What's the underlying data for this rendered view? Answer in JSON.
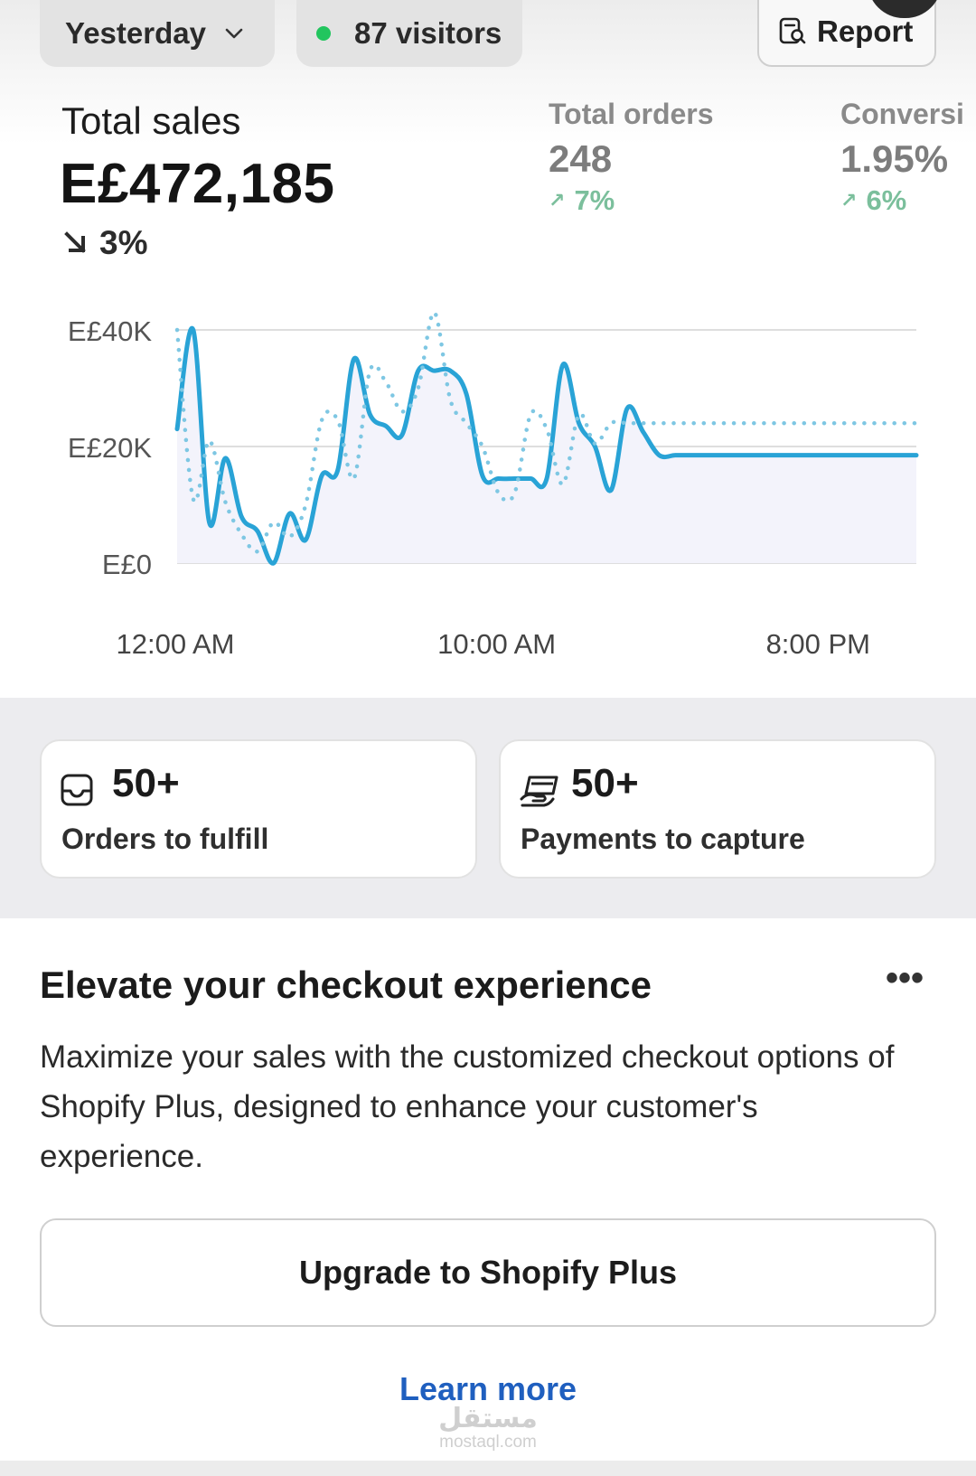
{
  "header": {
    "date_filter": "Yesterday",
    "visitors": "87 visitors",
    "report_label": "Report"
  },
  "metrics": {
    "total_sales": {
      "label": "Total sales",
      "value": "E£472,185",
      "change": "3%",
      "direction": "down"
    },
    "total_orders": {
      "label": "Total orders",
      "value": "248",
      "change": "7%",
      "direction": "up"
    },
    "conversion": {
      "label": "Conversi",
      "value": "1.95%",
      "change": "6%",
      "direction": "up"
    }
  },
  "chart_data": {
    "type": "line",
    "y_tick_labels": [
      "E£40K",
      "E£20K",
      "E£0"
    ],
    "x_tick_labels": [
      "12:00 AM",
      "10:00 AM",
      "8:00 PM"
    ],
    "ylim": [
      0,
      40000
    ],
    "grid": true,
    "x": [
      0,
      0.5,
      1,
      1.5,
      2,
      2.5,
      3,
      3.5,
      4,
      4.5,
      5,
      5.5,
      6,
      6.5,
      7,
      7.5,
      8,
      8.5,
      9,
      9.5,
      10,
      10.5,
      11,
      11.5,
      12,
      12.5,
      13,
      13.5,
      14,
      14.5,
      15,
      15.5,
      16,
      16.5,
      17,
      17.5,
      18,
      18.5,
      19,
      19.5,
      20,
      20.5,
      21,
      21.5,
      22,
      22.5,
      23
    ],
    "series": [
      {
        "style": "solid",
        "color": "#29a3d6",
        "values": [
          23000,
          40000,
          7000,
          18000,
          8000,
          5500,
          0,
          8500,
          4000,
          15000,
          16000,
          35000,
          25500,
          23500,
          22000,
          33000,
          33000,
          33000,
          29000,
          15000,
          14500,
          14500,
          14500,
          14500,
          34000,
          24000,
          20000,
          12500,
          26500,
          22500,
          18500,
          18500,
          18500,
          18500,
          18500,
          18500,
          18500,
          18500,
          18500,
          18500,
          18500,
          18500,
          18500,
          18500,
          18500,
          18500,
          18500
        ]
      },
      {
        "style": "dotted",
        "color": "#7ec7e3",
        "values": [
          40000,
          11000,
          21000,
          10500,
          5000,
          2000,
          7000,
          4500,
          10000,
          24500,
          24500,
          14500,
          33000,
          31000,
          26000,
          30000,
          43000,
          28000,
          24000,
          20000,
          12000,
          12000,
          25500,
          23000,
          13500,
          25500,
          20500,
          24000,
          24000,
          24000,
          24000,
          24000,
          24000,
          24000,
          24000,
          24000,
          24000,
          24000,
          24000,
          24000,
          24000,
          24000,
          24000,
          24000,
          24000,
          24000,
          24000
        ]
      }
    ]
  },
  "tasks": [
    {
      "count": "50+",
      "label": "Orders to fulfill",
      "icon": "inbox-icon"
    },
    {
      "count": "50+",
      "label": "Payments to capture",
      "icon": "payment-icon"
    }
  ],
  "promo": {
    "title": "Elevate your checkout experience",
    "body": "Maximize your sales with the customized checkout options of Shopify Plus, designed to enhance your customer's experience.",
    "button": "Upgrade to Shopify Plus",
    "link": "Learn more"
  },
  "watermark": {
    "line1": "مستقل",
    "line2": "mostaql.com"
  },
  "colors": {
    "accent_line": "#29a3d6",
    "dotted_line": "#7ec7e3",
    "positive": "#7bbf9c",
    "link": "#1f5fbf",
    "live_dot": "#22c55e"
  }
}
